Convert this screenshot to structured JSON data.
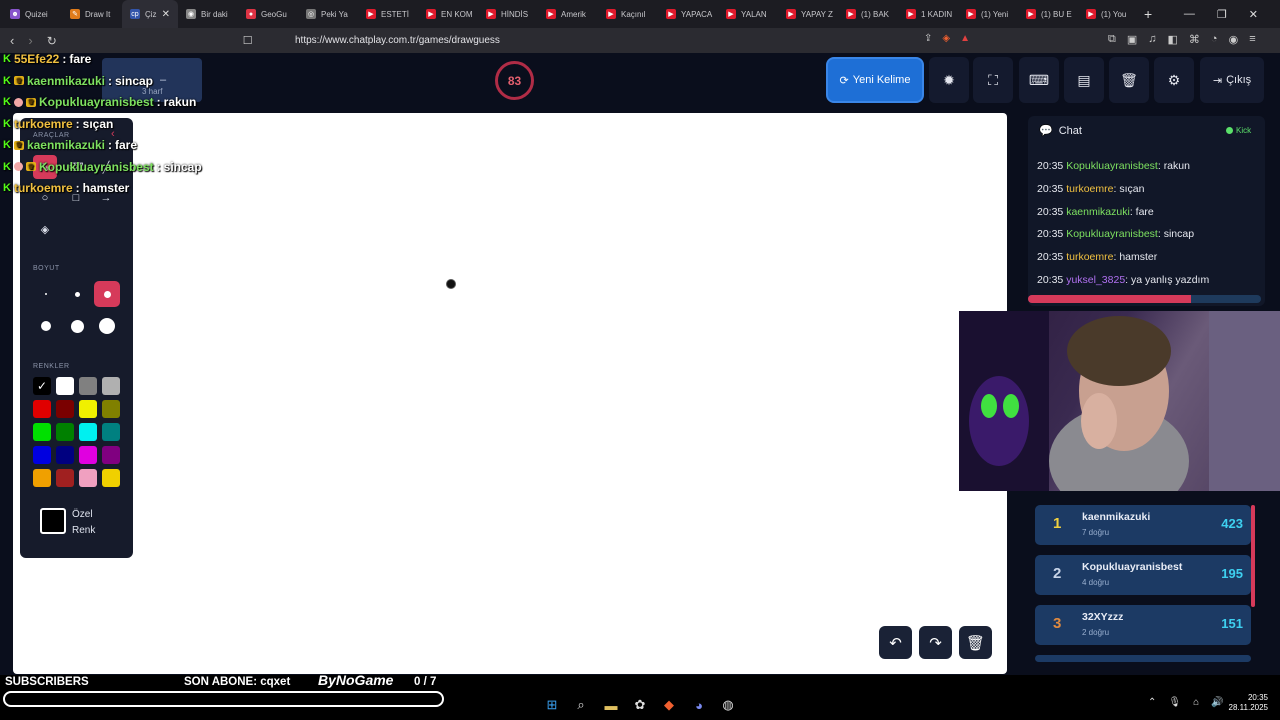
{
  "browser": {
    "tabs": [
      {
        "label": "Quizei",
        "icon": "☻",
        "color": "#8855cc"
      },
      {
        "label": "Draw It",
        "icon": "✎",
        "color": "#e07b1a"
      },
      {
        "label": "Çiz",
        "icon": "cp",
        "color": "#3355aa",
        "active": true
      },
      {
        "label": "Bir daki",
        "icon": "◉",
        "color": "#888"
      },
      {
        "label": "GeoGu",
        "icon": "●",
        "color": "#dd3344"
      },
      {
        "label": "Peki Ya",
        "icon": "◎",
        "color": "#777"
      },
      {
        "label": "ESTETİ",
        "icon": "▶",
        "color": "#e01a2c"
      },
      {
        "label": "EN KOM",
        "icon": "▶",
        "color": "#e01a2c"
      },
      {
        "label": "HİNDİS",
        "icon": "▶",
        "color": "#e01a2c"
      },
      {
        "label": "Amerik",
        "icon": "▶",
        "color": "#e01a2c"
      },
      {
        "label": "Kaçınıl",
        "icon": "▶",
        "color": "#e01a2c"
      },
      {
        "label": "YAPACA",
        "icon": "▶",
        "color": "#e01a2c"
      },
      {
        "label": "YALAN",
        "icon": "▶",
        "color": "#e01a2c"
      },
      {
        "label": "YAPAY Z",
        "icon": "▶",
        "color": "#e01a2c"
      },
      {
        "label": "(1) BAK",
        "icon": "▶",
        "color": "#e01a2c"
      },
      {
        "label": "1 KADIN",
        "icon": "▶",
        "color": "#e01a2c"
      },
      {
        "label": "(1) Yeni",
        "icon": "▶",
        "color": "#e01a2c"
      },
      {
        "label": "(1) BU E",
        "icon": "▶",
        "color": "#e01a2c"
      },
      {
        "label": "(1) You",
        "icon": "▶",
        "color": "#e01a2c"
      }
    ],
    "new_tab": "+",
    "url": "https://www.chatplay.com.tr/games/drawguess"
  },
  "header": {
    "hint_word": "–",
    "hint_sub": "3 harf",
    "timer": "83",
    "new_word_label": "Yeni Kelime",
    "exit_label": "Çıkış"
  },
  "tools": {
    "tools_title": "ARAÇLAR",
    "size_title": "BOYUT",
    "colors_title": "RENKLER",
    "custom_color_label": "Özel Renk",
    "colors": [
      "#000000",
      "#ffffff",
      "#808080",
      "#b0b0b0",
      "#e00000",
      "#7a0000",
      "#f0f000",
      "#808000",
      "#00e000",
      "#008000",
      "#00f0f0",
      "#008080",
      "#0000e0",
      "#000080",
      "#e000e0",
      "#800080",
      "#f0a000",
      "#a02020",
      "#f0a0c0",
      "#f0d000"
    ]
  },
  "overlay_chat": [
    {
      "user": "55Efe22",
      "msg": "fare",
      "color": "#f0c040",
      "badges": [
        "kick"
      ]
    },
    {
      "user": "kaenmikazuki",
      "msg": "sincap",
      "color": "#7de060",
      "badges": [
        "kick",
        "sub"
      ]
    },
    {
      "user": "Kopukluayranisbest",
      "msg": "rakun",
      "color": "#7de060",
      "badges": [
        "kick",
        "pink",
        "sub"
      ]
    },
    {
      "user": "turkoemre",
      "msg": "sıçan",
      "color": "#f0c040",
      "badges": [
        "kick"
      ]
    },
    {
      "user": "kaenmikazuki",
      "msg": "fare",
      "color": "#7de060",
      "badges": [
        "kick",
        "sub"
      ]
    },
    {
      "user": "Kopukluayranisbest",
      "msg": "sincap",
      "color": "#7de060",
      "badges": [
        "kick",
        "pink",
        "sub"
      ]
    },
    {
      "user": "turkoemre",
      "msg": "hamster",
      "color": "#f0c040",
      "badges": [
        "kick"
      ]
    }
  ],
  "chat": {
    "title": "Chat",
    "status": "Kick",
    "messages": [
      {
        "time": "20:35",
        "user": "Kopukluayranisbest",
        "msg": "rakun",
        "color": "#7de060"
      },
      {
        "time": "20:35",
        "user": "turkoemre",
        "msg": "sıçan",
        "color": "#f0c040"
      },
      {
        "time": "20:35",
        "user": "kaenmikazuki",
        "msg": "fare",
        "color": "#7de060"
      },
      {
        "time": "20:35",
        "user": "Kopukluayranisbest",
        "msg": "sincap",
        "color": "#7de060"
      },
      {
        "time": "20:35",
        "user": "turkoemre",
        "msg": "hamster",
        "color": "#f0c040"
      },
      {
        "time": "20:35",
        "user": "yuksel_3825",
        "msg": "ya yanlış yazdım",
        "color": "#b070f0"
      }
    ],
    "progress": 0.7
  },
  "leaderboard": [
    {
      "rank": "1",
      "name": "kaenmikazuki",
      "sub": "7 doğru",
      "score": "423",
      "rank_color": "#f0d040"
    },
    {
      "rank": "2",
      "name": "Kopukluayranisbest",
      "sub": "4 doğru",
      "score": "195",
      "rank_color": "#c8d4e8"
    },
    {
      "rank": "3",
      "name": "32XYzzz",
      "sub": "2 doğru",
      "score": "151",
      "rank_color": "#e08a40"
    }
  ],
  "stream": {
    "subscribers_label": "SUBSCRIBERS",
    "last_sub": "SON ABONE: cqxet",
    "brand": "ByNoGame",
    "goal": "0  / 7"
  },
  "taskbar": {
    "time": "20:35",
    "date": "28.11.2025"
  }
}
